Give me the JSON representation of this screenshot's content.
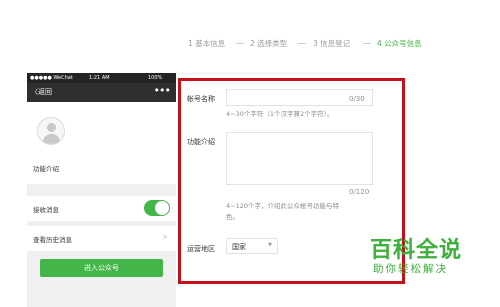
{
  "steps": [
    {
      "label": "1 基本信息"
    },
    {
      "label": "2 选择类型"
    },
    {
      "label": "3 信息登记"
    },
    {
      "label": "4 公众号信息"
    }
  ],
  "phone": {
    "status": {
      "carrier": "●●●●● WeChat",
      "time": "1:21 AM",
      "battery": "100%"
    },
    "nav": {
      "back": "〈返回",
      "more": "•••"
    },
    "func_intro": "功能介绍",
    "receive_label": "接收消息",
    "receive_on": true,
    "history_label": "查看历史消息",
    "history_chevron": ">",
    "enter_button": "进入公众号"
  },
  "form": {
    "account_label": "帐号名称",
    "account_value": "",
    "account_counter": "0/30",
    "account_hint": "4~30个字符（1个汉字算2个字符）。",
    "intro_label": "功能介绍",
    "intro_value": "",
    "intro_counter": "0/120",
    "intro_hint_line1": "4~120个字，介绍此公众帐号功能与特",
    "intro_hint_line2": "色。",
    "region_label": "运营地区",
    "region_value": "国家",
    "region_caret": "▼"
  },
  "watermark": {
    "logo": "百科全说",
    "sub": "助你轻松解决"
  },
  "colors": {
    "accent": "#44b549",
    "highlight_border": "#c41016",
    "watermark": "#3cb03a"
  }
}
